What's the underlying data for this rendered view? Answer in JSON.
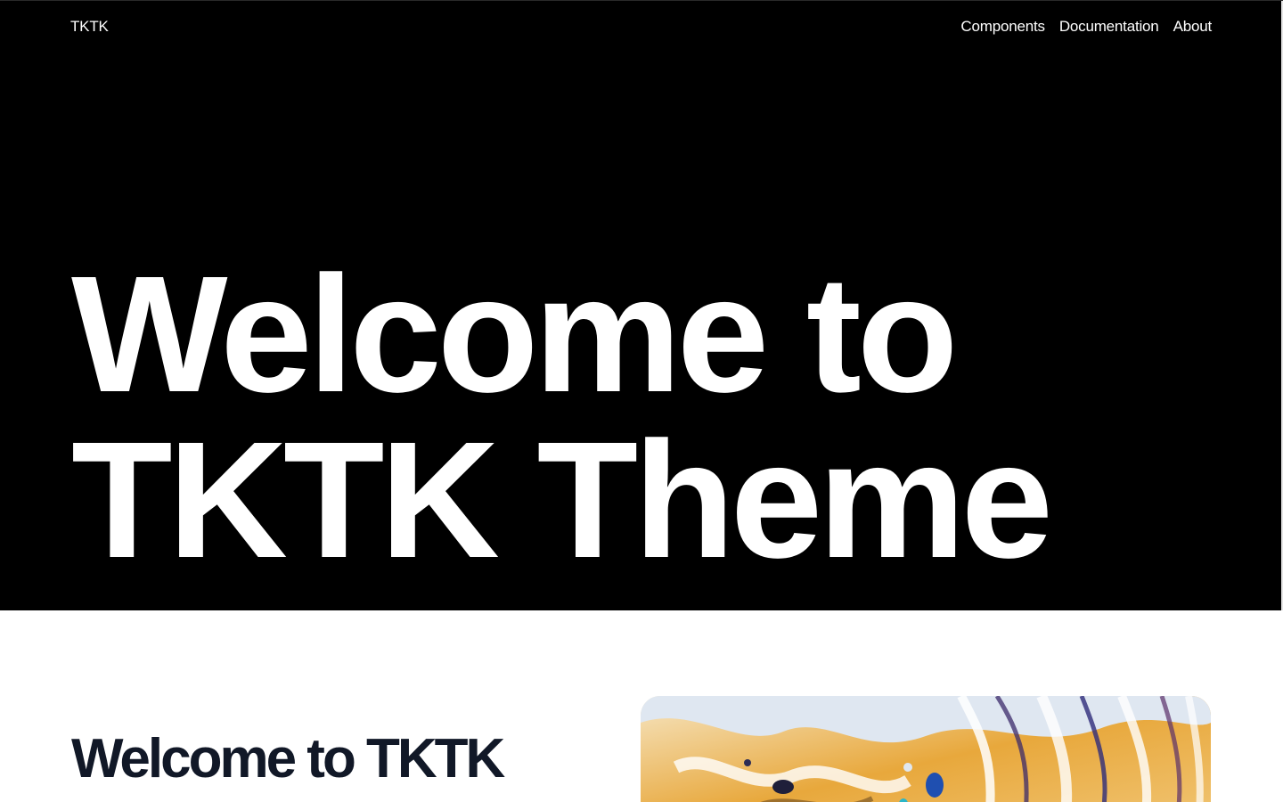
{
  "header": {
    "brand": "TKTK",
    "nav": [
      {
        "label": "Components"
      },
      {
        "label": "Documentation"
      },
      {
        "label": "About"
      }
    ]
  },
  "hero": {
    "title_line1": "Welcome to",
    "title_line2": "TKTK Theme"
  },
  "content": {
    "section_title": "Welcome to TKTK",
    "feature_image_desc": "abstract-swirl-image"
  },
  "colors": {
    "hero_bg": "#000000",
    "hero_text": "#ffffff",
    "heading_dark": "#111827"
  }
}
